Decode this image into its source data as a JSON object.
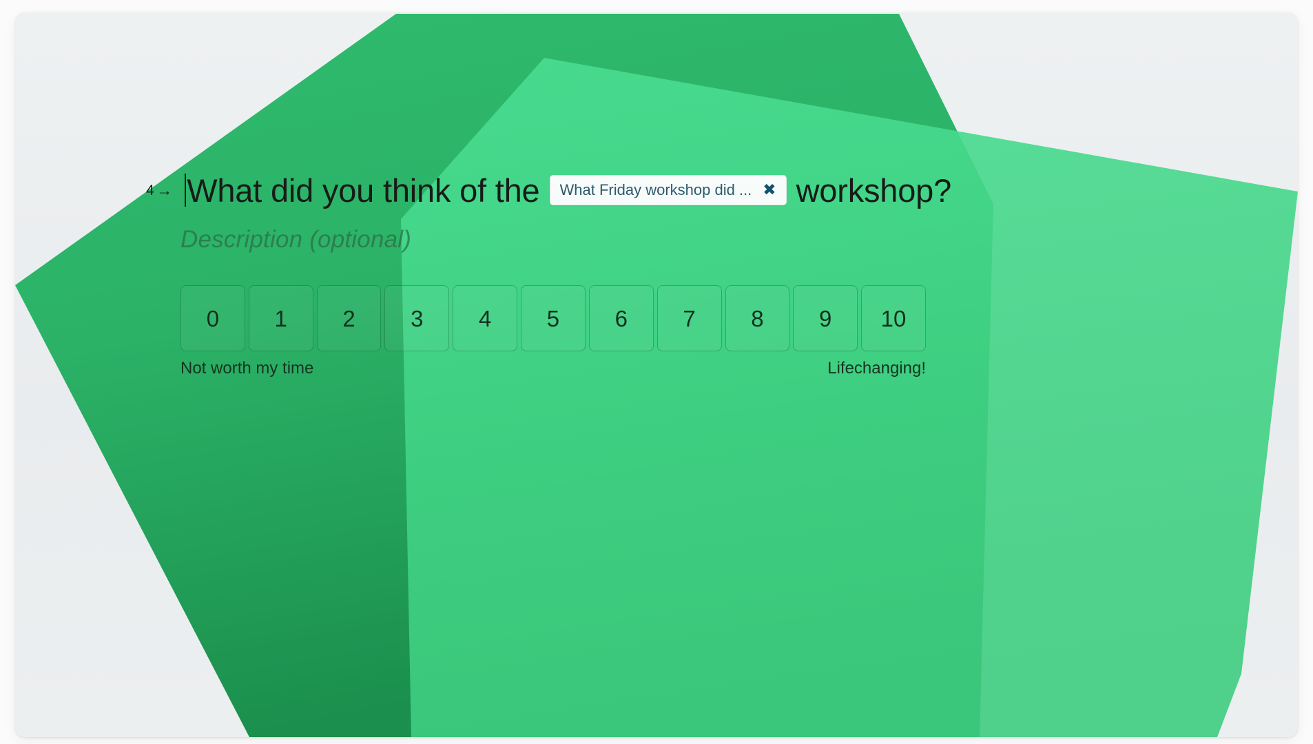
{
  "app": {
    "background_color": "#eceff0",
    "page_background_color": "#fbfbfb"
  },
  "decor": {
    "base_shape_color_top": "#2fb96d",
    "base_shape_color_bottom": "#1d9450",
    "overlay_shape_color": "#45d98a",
    "overlay_opacity": 0.9
  },
  "question": {
    "index": "4",
    "index_arrow": "→",
    "text_before_chip": "What did you think of the",
    "text_after_chip": "workshop?",
    "caret_visible": true,
    "chip": {
      "label": "What Friday workshop did ...",
      "remove_icon": "✖",
      "text_color": "#2d5b6b",
      "remove_color": "#11536d",
      "background_color": "#f7fbfa"
    },
    "description_placeholder": "Description (optional)"
  },
  "rating_scale": {
    "options": [
      "0",
      "1",
      "2",
      "3",
      "4",
      "5",
      "6",
      "7",
      "8",
      "9",
      "10"
    ],
    "min_label": "Not worth my time",
    "max_label": "Lifechanging!",
    "selected": null
  }
}
